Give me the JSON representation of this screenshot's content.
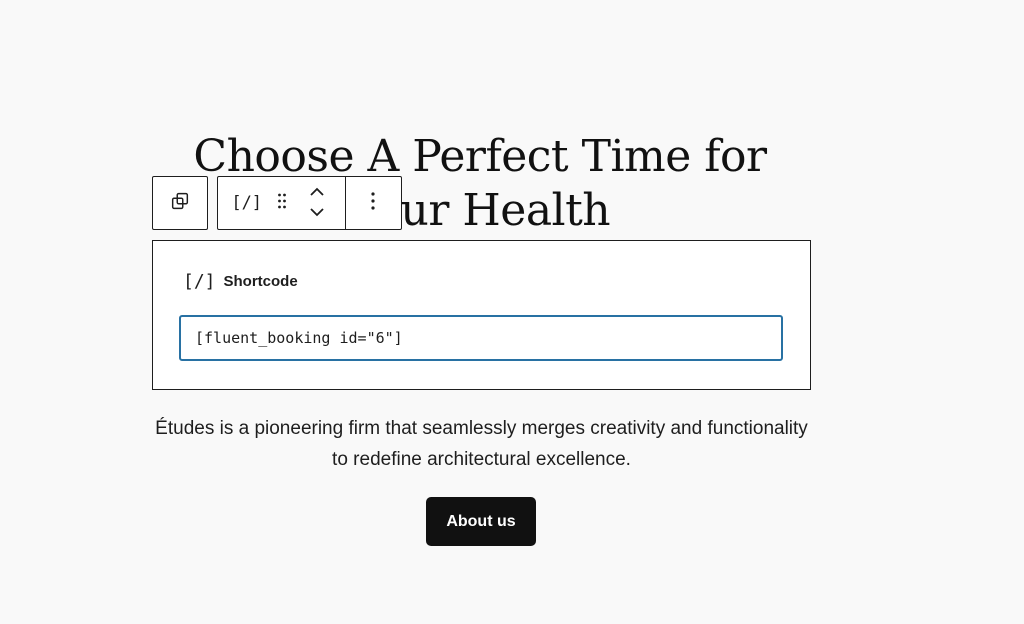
{
  "heading": "Choose A Perfect Time for Your Health",
  "toolbar": {
    "parent_icon": "select-parent-icon",
    "block_type_icon": "[/]",
    "drag_icon": "drag-handle-icon",
    "move_up_icon": "chevron-up-icon",
    "move_down_icon": "chevron-down-icon",
    "more_icon": "more-vertical-icon"
  },
  "shortcode": {
    "icon": "[/]",
    "label": "Shortcode",
    "value": "[fluent_booking id=\"6\"]"
  },
  "paragraph": "Études is a pioneering firm that seamlessly merges creativity and functionality to redefine architectural excellence.",
  "button": {
    "label": "About us"
  },
  "colors": {
    "background": "#f9f9f9",
    "input_focus": "#2871a3",
    "button_bg": "#111111"
  }
}
